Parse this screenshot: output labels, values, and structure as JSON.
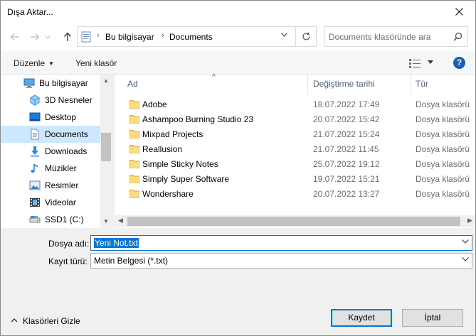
{
  "window": {
    "title": "Dışa Aktar..."
  },
  "address": {
    "crumbs": [
      "Bu bilgisayar",
      "Documents"
    ],
    "icon": "this-pc-icon"
  },
  "search": {
    "placeholder": "Documents klasöründe ara"
  },
  "commands": {
    "organize": "Düzenle",
    "new_folder": "Yeni klasör",
    "help": "?"
  },
  "sidebar": {
    "items": [
      {
        "label": "Bu bilgisayar",
        "icon": "this-pc-icon"
      },
      {
        "label": "3D Nesneler",
        "icon": "3d-objects-icon"
      },
      {
        "label": "Desktop",
        "icon": "desktop-icon"
      },
      {
        "label": "Documents",
        "icon": "documents-icon",
        "selected": true
      },
      {
        "label": "Downloads",
        "icon": "downloads-icon"
      },
      {
        "label": "Müzikler",
        "icon": "music-icon"
      },
      {
        "label": "Resimler",
        "icon": "pictures-icon"
      },
      {
        "label": "Videolar",
        "icon": "videos-icon"
      },
      {
        "label": "SSD1 (C:)",
        "icon": "drive-icon"
      }
    ]
  },
  "files": {
    "columns": {
      "name": "Ad",
      "date": "Değiştirme tarihi",
      "type": "Tür"
    },
    "rows": [
      {
        "name": "Adobe",
        "date": "18.07.2022 17:49",
        "type": "Dosya klasörü"
      },
      {
        "name": "Ashampoo Burning Studio 23",
        "date": "20.07.2022 15:42",
        "type": "Dosya klasörü"
      },
      {
        "name": "Mixpad Projects",
        "date": "21.07.2022 15:24",
        "type": "Dosya klasörü"
      },
      {
        "name": "Reallusion",
        "date": "21.07.2022 11:45",
        "type": "Dosya klasörü"
      },
      {
        "name": "Simple Sticky Notes",
        "date": "25.07.2022 19:12",
        "type": "Dosya klasörü"
      },
      {
        "name": "Simply Super Software",
        "date": "19.07.2022 15:21",
        "type": "Dosya klasörü"
      },
      {
        "name": "Wondershare",
        "date": "20.07.2022 13:27",
        "type": "Dosya klasörü"
      }
    ]
  },
  "form": {
    "filename_label": "Dosya adı:",
    "filename_value": "Yeni Not.txt",
    "filetype_label": "Kayıt türü:",
    "filetype_value": "Metin Belgesi (*.txt)"
  },
  "footer": {
    "hide_folders": "Klasörleri Gizle",
    "save": "Kaydet",
    "cancel": "İptal"
  },
  "colors": {
    "accent": "#0078d7",
    "selection": "#cce8ff",
    "folder": "#f8d775"
  }
}
